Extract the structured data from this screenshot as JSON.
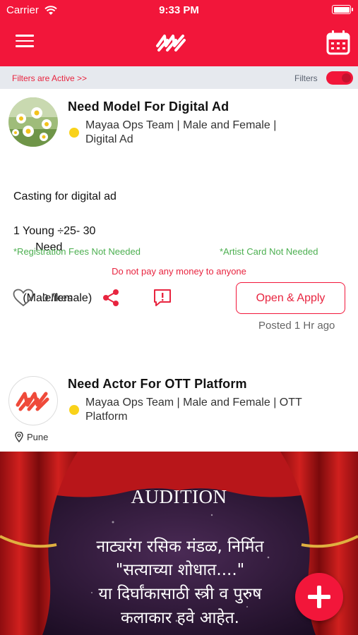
{
  "status_bar": {
    "carrier": "Carrier",
    "time": "9:33 PM"
  },
  "filters": {
    "active_link": "Filters are Active >>",
    "label": "Filters",
    "enabled": true
  },
  "colors": {
    "brand": "#f2163a",
    "status_dot": "#f9d21a",
    "fee_note": "#4caf50"
  },
  "cards": [
    {
      "title": "Need Model For Digital Ad",
      "meta_line1": "Mayaa Ops Team | Male and Female |",
      "meta_line2": "Digital Ad",
      "desc_line1": "Casting for digital ad",
      "desc_line2": "       Need",
      "desc_line3": "   (Male/female)",
      "desc_line4": "1 Young ÷25- 30",
      "registration_note": "*Registration Fees Not Needed",
      "artist_card_note": "*Artist Card Not Needed",
      "warning": "Do not pay any money to anyone",
      "likes": "0 likes",
      "apply_label": "Open & Apply",
      "posted": "Posted 1 Hr ago"
    },
    {
      "title": "Need Actor For OTT Platform",
      "meta_line1": "Mayaa Ops Team | Male and Female | OTT",
      "meta_line2": "Platform",
      "location": "Pune",
      "banner": {
        "heading": "AUDITION",
        "line1": "नाट्यरंग रसिक मंडळ, निर्मित",
        "line2": "\"सत्याच्या शोधात....\"",
        "line3": "या दिर्घांकासाठी स्त्री व पुरुष",
        "line4": "कलाकार हवे आहेत."
      }
    }
  ],
  "icons": {
    "menu": "menu-icon",
    "logo": "mayaa-logo",
    "calendar": "calendar-icon",
    "like": "heart-icon",
    "share": "share-icon",
    "report": "report-icon",
    "location": "location-pin-icon",
    "add": "plus-icon"
  }
}
